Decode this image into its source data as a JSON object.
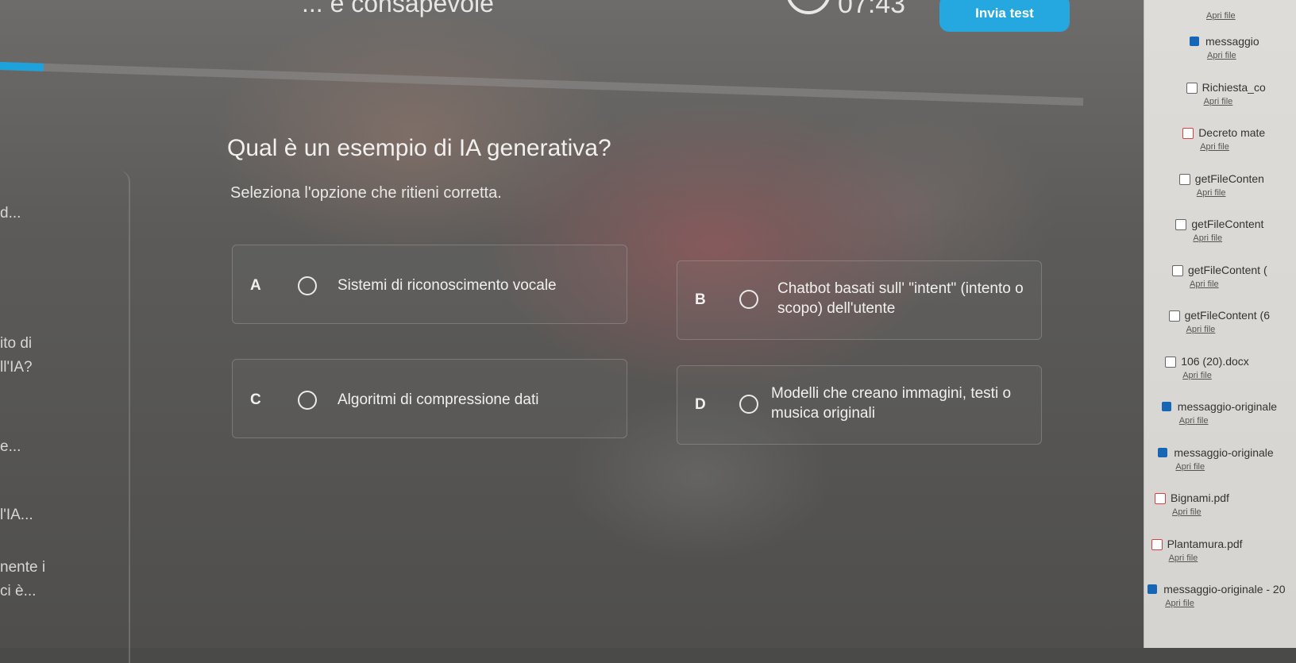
{
  "header": {
    "title": "... e consapevole",
    "timer": "07:43",
    "submit_label": "Invia test",
    "progress_percent": 4
  },
  "left_panel": {
    "snippets": [
      "d...",
      "ito di",
      "ll'IA?",
      "e...",
      "l'IA...",
      "nente i",
      "ci è..."
    ]
  },
  "question": {
    "text": "Qual è un esempio di IA generativa?",
    "instruction": "Seleziona l'opzione che ritieni corretta."
  },
  "options": [
    {
      "letter": "A",
      "text": "Sistemi di riconoscimento vocale"
    },
    {
      "letter": "B",
      "text": "Chatbot basati sull' \"intent\" (intento o scopo) dell'utente"
    },
    {
      "letter": "C",
      "text": "Algoritmi di compressione dati"
    },
    {
      "letter": "D",
      "text": "Modelli che creano immagini, testi o musica originali"
    }
  ],
  "sidebar": {
    "top_link": "Apri file",
    "files": [
      {
        "name": "messaggio",
        "icon": "outlook-icon",
        "open_label": "Apri file"
      },
      {
        "name": "Richiesta_co",
        "icon": "document-icon",
        "open_label": "Apri file"
      },
      {
        "name": "Decreto mate",
        "icon": "pdf-icon",
        "open_label": "Apri file"
      },
      {
        "name": "getFileConten",
        "icon": "document-icon",
        "open_label": "Apri file"
      },
      {
        "name": "getFileContent",
        "icon": "document-icon",
        "open_label": "Apri file"
      },
      {
        "name": "getFileContent (",
        "icon": "document-icon",
        "open_label": "Apri file"
      },
      {
        "name": "getFileContent (6",
        "icon": "document-icon",
        "open_label": "Apri file"
      },
      {
        "name": "106 (20).docx",
        "icon": "document-icon",
        "open_label": "Apri file"
      },
      {
        "name": "messaggio-originale",
        "icon": "outlook-icon",
        "open_label": "Apri file"
      },
      {
        "name": "messaggio-originale",
        "icon": "outlook-icon",
        "open_label": "Apri file"
      },
      {
        "name": "Bignami.pdf",
        "icon": "pdf-icon",
        "open_label": "Apri file"
      },
      {
        "name": "Plantamura.pdf",
        "icon": "pdf-icon",
        "open_label": "Apri file"
      },
      {
        "name": "messaggio-originale - 20",
        "icon": "outlook-icon",
        "open_label": "Apri file"
      }
    ]
  }
}
